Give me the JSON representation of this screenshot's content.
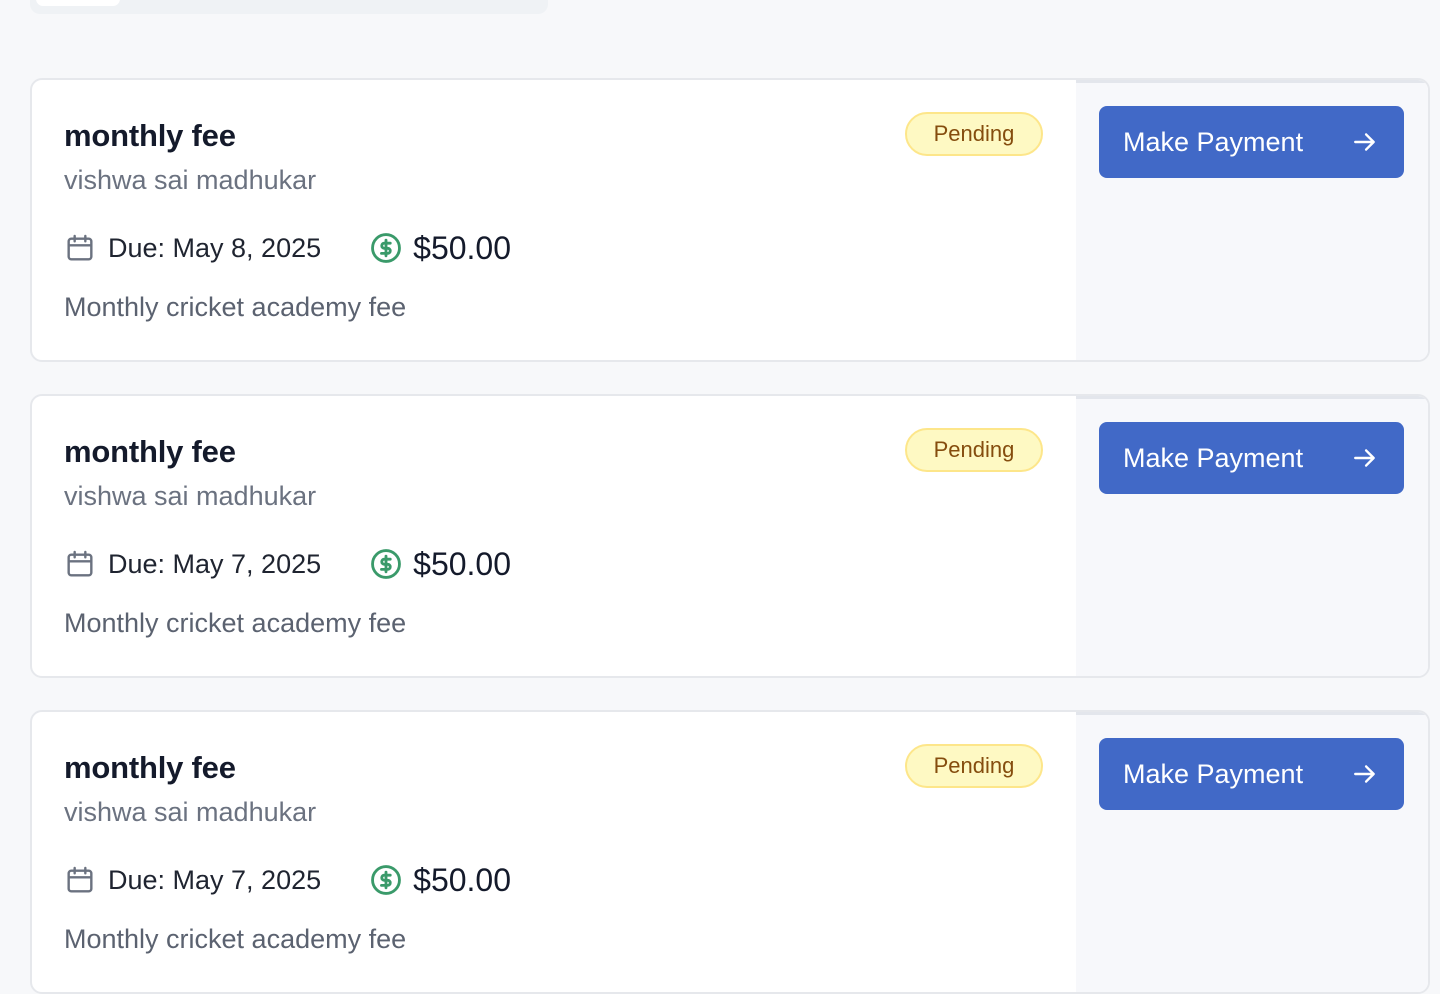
{
  "fees": [
    {
      "title": "monthly fee",
      "student": "vishwa sai madhukar",
      "status": "Pending",
      "due": "Due: May 8, 2025",
      "amount": "$50.00",
      "description": "Monthly cricket academy fee",
      "action_label": "Make Payment"
    },
    {
      "title": "monthly fee",
      "student": "vishwa sai madhukar",
      "status": "Pending",
      "due": "Due: May 7, 2025",
      "amount": "$50.00",
      "description": "Monthly cricket academy fee",
      "action_label": "Make Payment"
    },
    {
      "title": "monthly fee",
      "student": "vishwa sai madhukar",
      "status": "Pending",
      "due": "Due: May 7, 2025",
      "amount": "$50.00",
      "description": "Monthly cricket academy fee",
      "action_label": "Make Payment"
    }
  ],
  "icons": {
    "calendar": "calendar-icon",
    "amount": "dollar-circle-icon",
    "action": "arrow-right-icon"
  },
  "colors": {
    "primary_button": "#4169c7",
    "pending_badge_bg": "#fef9c3",
    "pending_badge_text": "#854d0e",
    "amount_icon": "#3a9a6a"
  }
}
